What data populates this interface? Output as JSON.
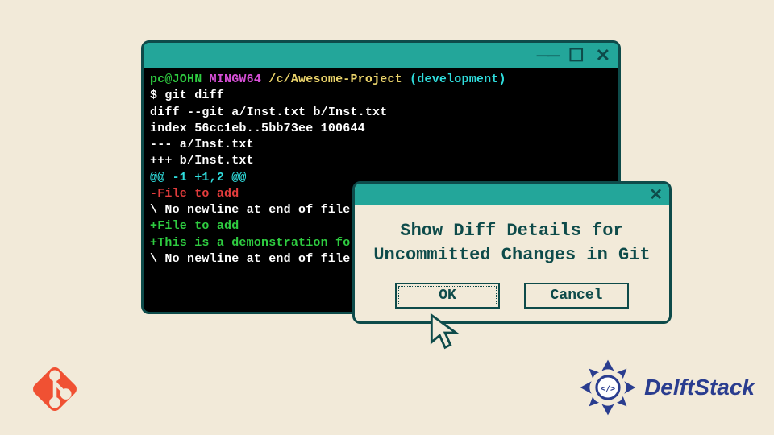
{
  "terminal": {
    "prompt": {
      "user": "pc@JOHN",
      "env": "MINGW64",
      "path": "/c/Awesome-Project",
      "branch": "(development)"
    },
    "command": "$ git diff",
    "lines": [
      {
        "cls": "c-white",
        "text": "diff --git a/Inst.txt b/Inst.txt"
      },
      {
        "cls": "c-white",
        "text": "index 56cc1eb..5bb73ee 100644"
      },
      {
        "cls": "c-white",
        "text": "--- a/Inst.txt"
      },
      {
        "cls": "c-white",
        "text": "+++ b/Inst.txt"
      },
      {
        "cls": "c-cyan",
        "text": "@@ -1 +1,2 @@"
      },
      {
        "cls": "c-red",
        "text": "-File to add"
      },
      {
        "cls": "c-white",
        "text": "\\ No newline at end of file"
      },
      {
        "cls": "c-green",
        "text": "+File to add"
      },
      {
        "cls": "c-green",
        "text": "+This is a demonstration for"
      },
      {
        "cls": "c-white",
        "text": "\\ No newline at end of file"
      }
    ]
  },
  "dialog": {
    "message": "Show Diff Details for Uncommitted Changes in Git",
    "ok_label": "OK",
    "cancel_label": "Cancel"
  },
  "brand": "DelftStack",
  "colors": {
    "teal": "#23a69a",
    "darkteal": "#0e4b4a",
    "bg": "#f2ead9",
    "git": "#f05133",
    "delft": "#2a3d8f"
  }
}
